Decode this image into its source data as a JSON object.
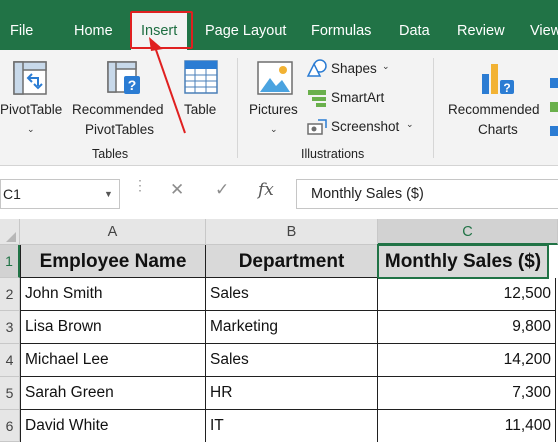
{
  "ribbon_tabs": [
    "File",
    "Home",
    "Insert",
    "Page Layout",
    "Formulas",
    "Data",
    "Review",
    "View"
  ],
  "active_tab": "Insert",
  "ribbon": {
    "tables_group": {
      "label": "Tables",
      "pivottable": "PivotTable",
      "recommended_pivottables_line1": "Recommended",
      "recommended_pivottables_line2": "PivotTables",
      "table": "Table"
    },
    "illustrations_group": {
      "label": "Illustrations",
      "pictures": "Pictures",
      "shapes": "Shapes",
      "smartart": "SmartArt",
      "screenshot": "Screenshot"
    },
    "charts_group": {
      "recommended_charts_line1": "Recommended",
      "recommended_charts_line2": "Charts"
    }
  },
  "formula_bar": {
    "name_box": "C1",
    "fx_label": "fx",
    "content": "Monthly Sales ($)"
  },
  "columns": [
    "A",
    "B",
    "C"
  ],
  "rows": [
    "1",
    "2",
    "3",
    "4",
    "5",
    "6"
  ],
  "table": {
    "headers": [
      "Employee Name",
      "Department",
      "Monthly Sales ($)"
    ],
    "data": [
      [
        "John Smith",
        "Sales",
        "12,500"
      ],
      [
        "Lisa Brown",
        "Marketing",
        "9,800"
      ],
      [
        "Michael Lee",
        "Sales",
        "14,200"
      ],
      [
        "Sarah Green",
        "HR",
        "7,300"
      ],
      [
        "David White",
        "IT",
        "11,400"
      ]
    ]
  },
  "colors": {
    "brand_green": "#217346",
    "highlight_red": "#e02020",
    "header_fill": "#d9d9d9"
  }
}
